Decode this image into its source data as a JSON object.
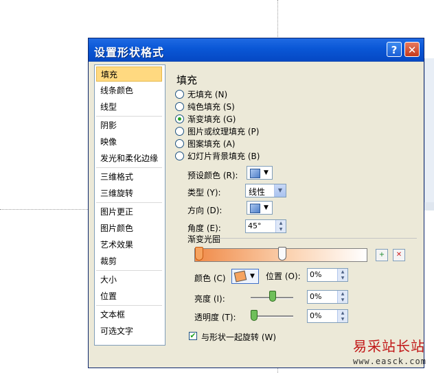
{
  "dialog": {
    "title": "设置形状格式",
    "help_label": "?",
    "close_label": "✕"
  },
  "nav": {
    "items": [
      {
        "label": "填充",
        "selected": true
      },
      {
        "label": "线条颜色"
      },
      {
        "label": "线型"
      },
      {
        "label": "阴影"
      },
      {
        "label": "映像"
      },
      {
        "label": "发光和柔化边缘"
      },
      {
        "label": "三维格式"
      },
      {
        "label": "三维旋转"
      },
      {
        "label": "图片更正"
      },
      {
        "label": "图片颜色"
      },
      {
        "label": "艺术效果"
      },
      {
        "label": "裁剪"
      },
      {
        "label": "大小"
      },
      {
        "label": "位置"
      },
      {
        "label": "文本框"
      },
      {
        "label": "可选文字"
      }
    ]
  },
  "fill": {
    "heading": "填充",
    "options": [
      {
        "label": "无填充 (N)",
        "checked": false
      },
      {
        "label": "纯色填充 (S)",
        "checked": false
      },
      {
        "label": "渐变填充 (G)",
        "checked": true
      },
      {
        "label": "图片或纹理填充 (P)",
        "checked": false
      },
      {
        "label": "图案填充 (A)",
        "checked": false
      },
      {
        "label": "幻灯片背景填充 (B)",
        "checked": false
      }
    ],
    "preset_label": "预设颜色 (R):",
    "type_label": "类型 (Y):",
    "type_value": "线性",
    "direction_label": "方向 (D):",
    "angle_label": "角度 (E):",
    "angle_value": "45°",
    "stops_heading": "渐变光圈",
    "color_label": "颜色 (C)",
    "position_label": "位置 (O):",
    "position_value": "0%",
    "brightness_label": "亮度 (I):",
    "brightness_value": "0%",
    "transparency_label": "透明度 (T):",
    "transparency_value": "0%",
    "rotate_with_shape_label": "与形状一起旋转 (W)",
    "rotate_with_shape_checked": true
  },
  "watermark": {
    "main": "易采站长站",
    "url": "www.easck.com"
  }
}
